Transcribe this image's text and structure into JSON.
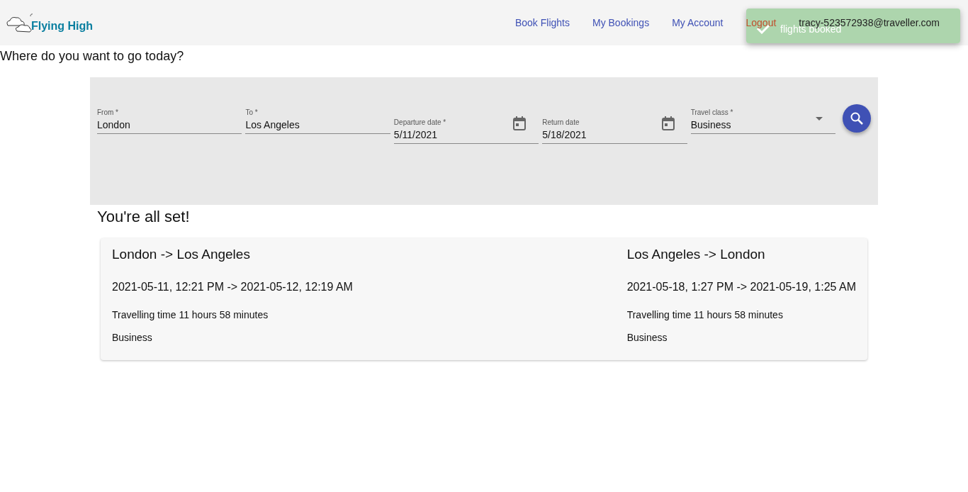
{
  "header": {
    "logo": "Flying High",
    "nav": [
      {
        "label": "Book Flights",
        "kind": "link"
      },
      {
        "label": "My Bookings",
        "kind": "link"
      },
      {
        "label": "My Account",
        "kind": "link"
      },
      {
        "label": "Logout",
        "kind": "logout"
      }
    ],
    "user": "tracy-523572938@traveller.com"
  },
  "toast": {
    "message": "flights booked"
  },
  "heading": "Where do you want to go today?",
  "search": {
    "fields": [
      {
        "label": "From *",
        "value": "London",
        "kind": "text"
      },
      {
        "label": "To *",
        "value": "Los Angeles",
        "kind": "text"
      },
      {
        "label": "Departure date *",
        "value": "5/11/2021",
        "kind": "date"
      },
      {
        "label": "Return date",
        "value": "5/18/2021",
        "kind": "date"
      },
      {
        "label": "Travel class *",
        "value": "Business",
        "kind": "select"
      }
    ]
  },
  "result": {
    "title": "You're all set!",
    "legs": [
      {
        "route": "London -> Los Angeles",
        "times": "2021-05-11, 12:21 PM -> 2021-05-12, 12:19 AM",
        "duration": "Travelling time 11 hours 58 minutes",
        "class": "Business"
      },
      {
        "route": "Los Angeles -> London",
        "times": "2021-05-18, 1:27 PM -> 2021-05-19, 1:25 AM",
        "duration": "Travelling time 11 hours 58 minutes",
        "class": "Business"
      }
    ]
  }
}
